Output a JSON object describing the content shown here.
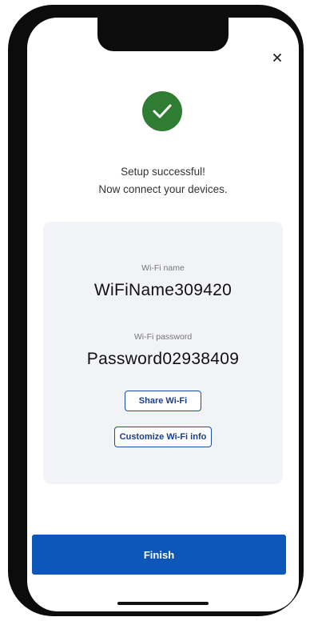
{
  "header": {
    "close_icon": "close-icon"
  },
  "status": {
    "icon": "checkmark-icon",
    "icon_color": "#2e7d32",
    "line1": "Setup successful!",
    "line2": "Now connect your devices."
  },
  "wifi": {
    "name_label": "Wi-Fi name",
    "name_value": "WiFiName309420",
    "password_label": "Wi-Fi password",
    "password_value": "Password02938409"
  },
  "actions": {
    "share_label": "Share Wi-Fi",
    "customize_label": "Customize Wi-Fi info",
    "finish_label": "Finish"
  },
  "colors": {
    "primary": "#0d57b8",
    "success": "#2e7d32",
    "card_bg": "#f2f3f6"
  }
}
